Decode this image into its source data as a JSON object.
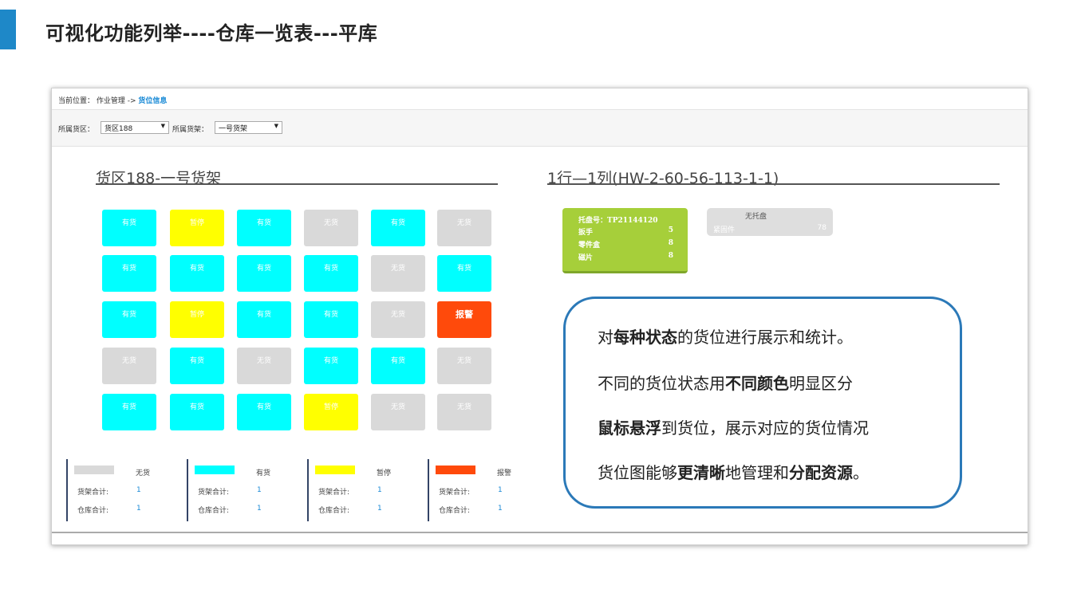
{
  "slide": {
    "title": "可视化功能列举----仓库一览表---平库",
    "accent_color": "#1e88c8"
  },
  "breadcrumb": {
    "prefix": "当前位置：",
    "parent": "作业管理 ->",
    "current": "货位信息"
  },
  "filters": {
    "zone_label": "所属货区：",
    "zone_value": "货区188",
    "shelf_label": "所属货架：",
    "shelf_value": "一号货架"
  },
  "left_panel": {
    "title": "货区188-一号货架"
  },
  "right_panel": {
    "title": "1行—1列(HW-2-60-56-113-1-1)"
  },
  "statuses": {
    "has": {
      "label": "有货",
      "color": "#00ffff"
    },
    "paused": {
      "label": "暂停",
      "color": "#ffff00"
    },
    "empty": {
      "label": "无货",
      "color": "#d9d9d9"
    },
    "alarm": {
      "label": "报警",
      "color": "#ff4a0b"
    }
  },
  "grid": [
    [
      "has",
      "paused",
      "has",
      "empty",
      "has",
      "empty"
    ],
    [
      "has",
      "has",
      "has",
      "has",
      "empty",
      "has"
    ],
    [
      "has",
      "paused",
      "has",
      "has",
      "empty",
      "alarm"
    ],
    [
      "empty",
      "has",
      "empty",
      "has",
      "has",
      "empty"
    ],
    [
      "has",
      "has",
      "has",
      "paused",
      "empty",
      "empty"
    ]
  ],
  "legend": [
    {
      "name": "无货",
      "color": "#d9d9d9",
      "shelf_label": "货架合计:",
      "shelf_total": "1",
      "warehouse_label": "仓库合计:",
      "warehouse_total": "1"
    },
    {
      "name": "有货",
      "color": "#00ffff",
      "shelf_label": "货架合计:",
      "shelf_total": "1",
      "warehouse_label": "仓库合计:",
      "warehouse_total": "1"
    },
    {
      "name": "暂停",
      "color": "#ffff00",
      "shelf_label": "货架合计:",
      "shelf_total": "1",
      "warehouse_label": "仓库合计:",
      "warehouse_total": "1"
    },
    {
      "name": "报警",
      "color": "#ff4a0b",
      "shelf_label": "货架合计:",
      "shelf_total": "1",
      "warehouse_label": "仓库合计:",
      "warehouse_total": "1"
    }
  ],
  "pallet": {
    "id_label": "托盘号：TP21144120",
    "items": [
      {
        "name": "扳手",
        "qty": "5"
      },
      {
        "name": "零件盒",
        "qty": "8"
      },
      {
        "name": "磁片",
        "qty": "8"
      }
    ]
  },
  "no_pallet": {
    "title": "无托盘",
    "item_name": "紧固件",
    "item_qty": "78"
  },
  "info_box": {
    "line1": {
      "a": "对",
      "b": "每种状态",
      "c": "的货位进行展示和统计。"
    },
    "line2": {
      "a": "不同的货位状态用",
      "b": "不同颜色",
      "c": "明显区分"
    },
    "line3": {
      "a": "鼠标悬浮",
      "b": "到货位，展示对应的货位情况"
    },
    "line4": {
      "a": "货位图能够",
      "b": "更清晰",
      "c": "地管理和",
      "d": "分配资源",
      "e": "。"
    }
  }
}
